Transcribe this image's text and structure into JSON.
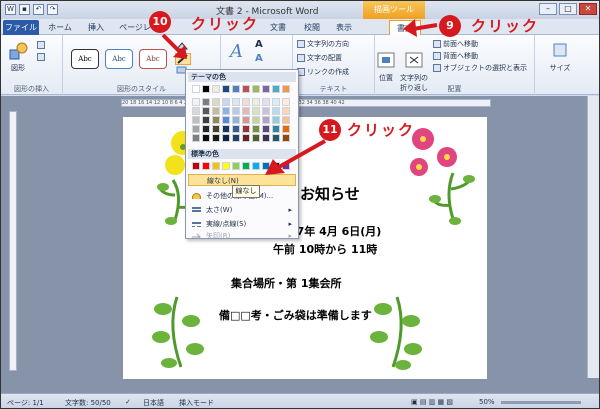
{
  "window": {
    "title": "文書 2 - Microsoft Word",
    "context_tab": "描画ツール"
  },
  "tabs": [
    "ファイル",
    "ホーム",
    "挿入",
    "ページレイ",
    "文書",
    "校閲",
    "表示",
    "書式"
  ],
  "ribbon": {
    "insert_shape_label": "図形",
    "insert_group": "図形の挿入",
    "style_samples": [
      "Abc",
      "Abc",
      "Abc"
    ],
    "styles_group": "図形のスタイル",
    "text_direction": "文字列の方向",
    "text_position": "文字の配置",
    "create_link": "リンクの作成",
    "text_group": "テキスト",
    "position_label": "位置",
    "wrap_label": "文字列の折り返し",
    "bring_front": "前面へ移動",
    "send_back": "背面へ移動",
    "selection_pane": "オブジェクトの選択と表示",
    "arrange_group": "配置",
    "size_label": "サイズ"
  },
  "menu": {
    "theme_colors": "テーマの色",
    "standard_colors": "標準の色",
    "no_line": "線なし(N)",
    "other_colors": "その他の線の色(M)...",
    "weight": "太さ(W)",
    "dashes": "実線/点線(S)",
    "arrows": "矢印(R)",
    "tooltip": "線なし",
    "theme_palette": [
      [
        "#ffffff",
        "#000000",
        "#eeece1",
        "#1f497d",
        "#4f81bd",
        "#c0504d",
        "#9bbb59",
        "#8064a2",
        "#4bacc6",
        "#f79646"
      ],
      [
        "#f2f2f2",
        "#7f7f7f",
        "#ddd9c3",
        "#c6d9f0",
        "#dbe5f1",
        "#f2dcdb",
        "#ebf1dd",
        "#e5e0ec",
        "#dbeef3",
        "#fdeada"
      ],
      [
        "#d8d8d8",
        "#595959",
        "#c4bd97",
        "#8db3e2",
        "#b8cce4",
        "#e5b9b7",
        "#d7e3bc",
        "#ccc1d9",
        "#b7dde8",
        "#fbd5b5"
      ],
      [
        "#bfbfbf",
        "#3f3f3f",
        "#938953",
        "#548dd4",
        "#95b3d7",
        "#d99694",
        "#c3d69b",
        "#b2a2c7",
        "#92cddc",
        "#fac08f"
      ],
      [
        "#a5a5a5",
        "#262626",
        "#494429",
        "#17365d",
        "#366092",
        "#953734",
        "#76923c",
        "#5f497a",
        "#31859b",
        "#e36c09"
      ],
      [
        "#7f7f7f",
        "#0c0c0c",
        "#1d1b10",
        "#0f243e",
        "#244061",
        "#632423",
        "#4f6128",
        "#3f3151",
        "#205867",
        "#974806"
      ]
    ],
    "standard_palette": [
      "#c00000",
      "#ff0000",
      "#ffc000",
      "#ffff00",
      "#92d050",
      "#00b050",
      "#00b0f0",
      "#0070c0",
      "#002060",
      "#7030a0"
    ]
  },
  "document": {
    "heading": "のお知らせ",
    "date": "27年 4月 6日(月)",
    "time": "午前 10時から 11時",
    "place": "集合場所・第 1集会所",
    "note": "備□□考・ごみ袋は準備します"
  },
  "annotations": {
    "step9": "9",
    "step10": "10",
    "step11": "11",
    "click": "クリック"
  },
  "statusbar": {
    "page": "ページ: 1/1",
    "words": "文字数: 50/50",
    "lang": "日本語",
    "mode": "挿入モード",
    "zoom": "50%"
  }
}
